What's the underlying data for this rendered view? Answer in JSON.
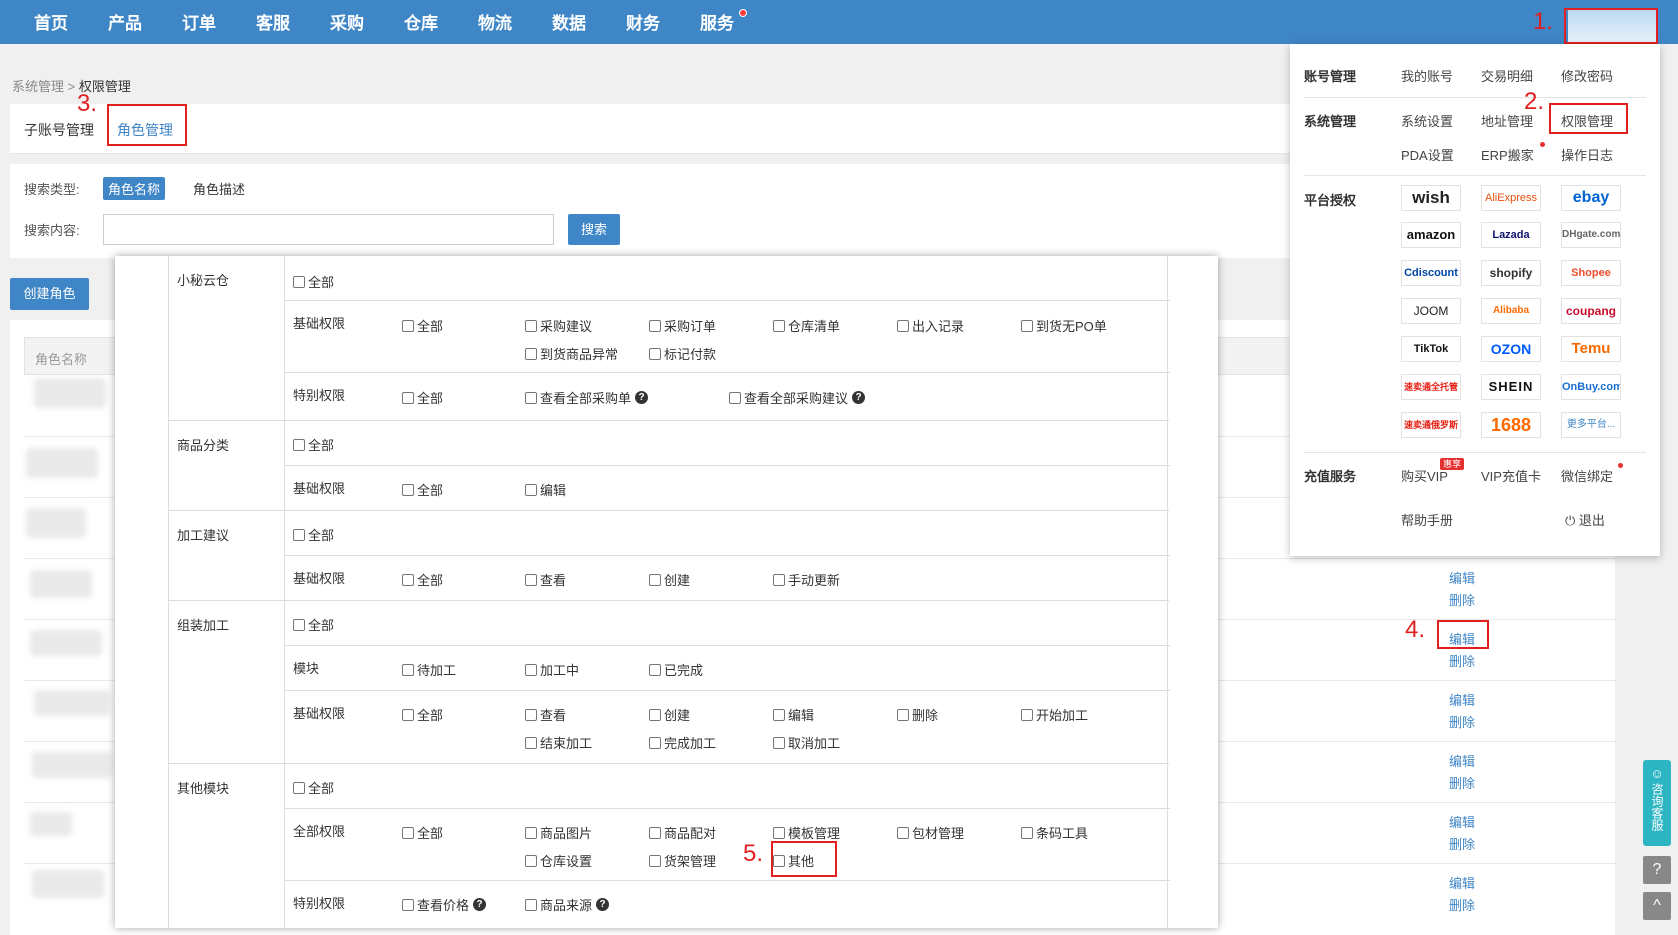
{
  "nav": {
    "items": [
      "首页",
      "产品",
      "订单",
      "客服",
      "采购",
      "仓库",
      "物流",
      "数据",
      "财务",
      "服务"
    ]
  },
  "steps": {
    "s1": "1.",
    "s2": "2.",
    "s3": "3.",
    "s4": "4.",
    "s5": "5."
  },
  "breadcrumb": {
    "parent": "系统管理",
    "separator": ">",
    "current": "权限管理"
  },
  "tabs": [
    "子账号管理",
    "角色管理"
  ],
  "search": {
    "type_label": "搜索类型:",
    "type_options": [
      "角色名称",
      "角色描述"
    ],
    "content_label": "搜索内容:",
    "input_value": "",
    "button": "搜索"
  },
  "create_button": "创建角色",
  "list": {
    "header": "角色名称",
    "actions": {
      "edit": "编辑",
      "delete": "删除"
    }
  },
  "modal": {
    "sections": [
      {
        "name": "小秘云仓",
        "all": "全部",
        "rows": [
          {
            "label": "基础权限",
            "items": [
              "全部",
              "采购建议",
              "采购订单",
              "仓库清单",
              "出入记录",
              "到货无PO单",
              "到货商品异常",
              "标记付款"
            ]
          },
          {
            "label": "特别权限",
            "items": [
              "全部",
              "查看全部采购单",
              "查看全部采购建议"
            ]
          }
        ]
      },
      {
        "name": "商品分类",
        "all": "全部",
        "rows": [
          {
            "label": "基础权限",
            "items": [
              "全部",
              "编辑"
            ]
          }
        ]
      },
      {
        "name": "加工建议",
        "all": "全部",
        "rows": [
          {
            "label": "基础权限",
            "items": [
              "全部",
              "查看",
              "创建",
              "手动更新"
            ]
          }
        ]
      },
      {
        "name": "组装加工",
        "all": "全部",
        "rows": [
          {
            "label": "模块",
            "items": [
              "待加工",
              "加工中",
              "已完成"
            ]
          },
          {
            "label": "基础权限",
            "items": [
              "全部",
              "查看",
              "创建",
              "编辑",
              "删除",
              "开始加工",
              "结束加工",
              "完成加工",
              "取消加工"
            ]
          }
        ]
      },
      {
        "name": "其他模块",
        "all": "全部",
        "rows": [
          {
            "label": "全部权限",
            "items": [
              "全部",
              "商品图片",
              "商品配对",
              "模板管理",
              "包材管理",
              "条码工具",
              "仓库设置",
              "货架管理",
              "其他"
            ]
          },
          {
            "label": "特别权限",
            "items": [
              "查看价格",
              "商品来源"
            ]
          }
        ]
      }
    ]
  },
  "dropdown": {
    "account": {
      "title": "账号管理",
      "links": [
        "我的账号",
        "交易明细",
        "修改密码"
      ]
    },
    "system": {
      "title": "系统管理",
      "links": [
        "系统设置",
        "地址管理",
        "权限管理",
        "PDA设置",
        "ERP搬家",
        "操作日志"
      ]
    },
    "platforms": {
      "title": "平台授权",
      "logos": [
        "wish",
        "AliExpress",
        "ebay",
        "amazon",
        "Lazada",
        "DHgate.com",
        "Cdiscount",
        "shopify",
        "Shopee",
        "JOOM",
        "Alibaba",
        "coupang",
        "TikTok",
        "OZON",
        "Temu",
        "速卖通全托管",
        "SHEIN",
        "OnBuy.com",
        "速卖通俄罗斯",
        "1688",
        "更多平台..."
      ]
    },
    "recharge": {
      "title": "充值服务",
      "links": [
        "购买VIP",
        "VIP充值卡",
        "微信绑定"
      ],
      "badge": "惠享"
    },
    "footer": {
      "help": "帮助手册",
      "logout": "退出"
    }
  },
  "side": {
    "consult": "咨询客服",
    "help_icon": "?",
    "top_icon": "^"
  },
  "colors": {
    "primary": "#3f86c6",
    "highlight": "#e02020"
  }
}
